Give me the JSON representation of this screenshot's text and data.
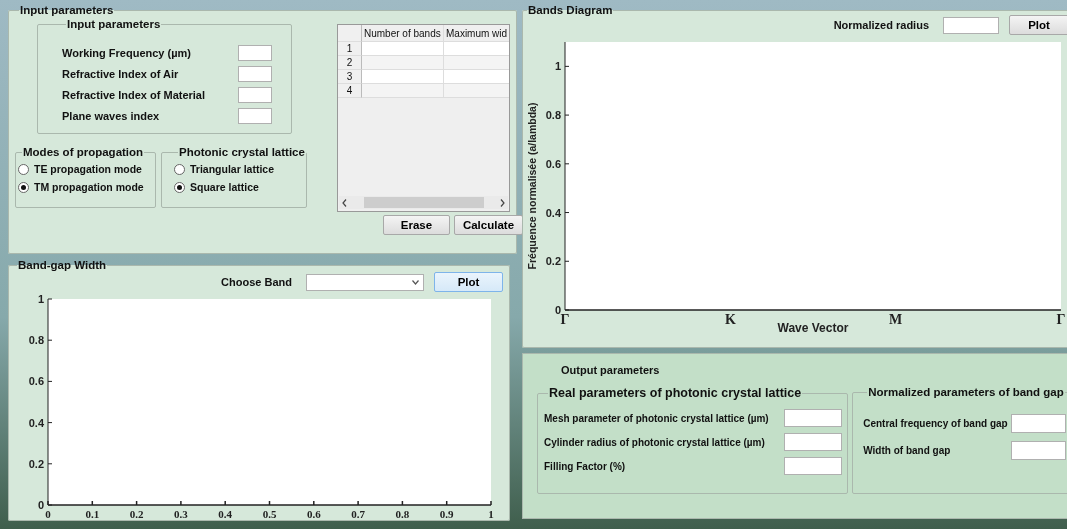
{
  "input_panel": {
    "title": "Input parameters",
    "input_group": {
      "title": "Input parameters",
      "fields": [
        {
          "label": "Working Frequency (µm)"
        },
        {
          "label": "Refractive Index of Air"
        },
        {
          "label": "Refractive Index of Material"
        },
        {
          "label": "Plane waves index"
        }
      ]
    },
    "modes_group": {
      "title": "Modes of propagation",
      "options": [
        {
          "label": "TE propagation mode",
          "selected": false
        },
        {
          "label": "TM propagation mode",
          "selected": true
        }
      ]
    },
    "lattice_group": {
      "title": "Photonic crystal lattice",
      "options": [
        {
          "label": "Triangular lattice",
          "selected": false
        },
        {
          "label": "Square lattice",
          "selected": true
        }
      ]
    },
    "table": {
      "columns": [
        "Number of bands",
        "Maximum wid"
      ],
      "rows": [
        "1",
        "2",
        "3",
        "4"
      ]
    },
    "buttons": [
      "Erase",
      "Calculate"
    ]
  },
  "bandgap_panel": {
    "title": "Band-gap Width",
    "choose_label": "Choose Band",
    "plot_button": {
      "label": "Plot",
      "focused": true
    },
    "chart_data": {
      "type": "line",
      "xlim": [
        0,
        1
      ],
      "ylim": [
        0,
        1
      ],
      "xticks": [
        0,
        0.1,
        0.2,
        0.3,
        0.4,
        0.5,
        0.6,
        0.7,
        0.8,
        0.9,
        1
      ],
      "yticks": [
        0,
        0.2,
        0.4,
        0.6,
        0.8,
        1
      ]
    }
  },
  "bands_panel": {
    "title": "Bands Diagram",
    "radius_label": "Normalized radius",
    "plot_button": {
      "label": "Plot",
      "focused": false
    },
    "chart_data": {
      "type": "line",
      "xlabel": "Wave Vector",
      "ylabel": "Fréquence normalisée (a/lambda)",
      "categories": [
        "Γ",
        "K",
        "M",
        "Γ"
      ],
      "ylim": [
        0,
        1.1
      ],
      "yticks": [
        0,
        0.2,
        0.4,
        0.6,
        0.8,
        1
      ]
    }
  },
  "output_panel": {
    "title": "Output parameters",
    "real_group": {
      "title": "Real parameters of photonic crystal lattice",
      "fields": [
        {
          "label": "Mesh parameter of photonic crystal lattice (µm)"
        },
        {
          "label": "Cylinder radius of photonic crystal lattice (µm)"
        },
        {
          "label": "Filling Factor  (%)"
        }
      ]
    },
    "normalized_group": {
      "title": "Normalized parameters  of band gap",
      "fields": [
        {
          "label": "Central frequency of band gap"
        },
        {
          "label": "Width of band gap"
        }
      ]
    }
  }
}
